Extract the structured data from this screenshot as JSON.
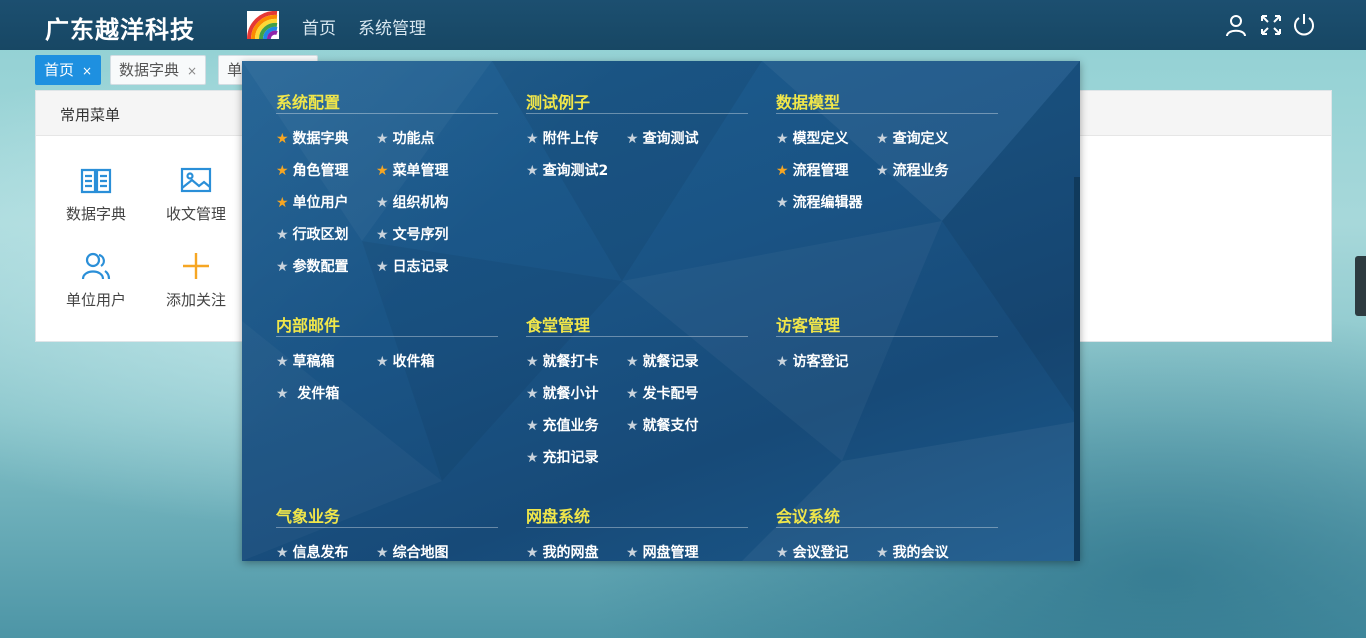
{
  "header": {
    "brand": "广东越洋科技",
    "nav": [
      {
        "label": "首页"
      },
      {
        "label": "系统管理"
      }
    ],
    "icons": [
      "user-icon",
      "fullscreen-icon",
      "power-icon"
    ]
  },
  "tabs": [
    {
      "label": "首页",
      "close": "×",
      "active": true
    },
    {
      "label": "数据字典",
      "close": "×",
      "active": false
    },
    {
      "label": "单",
      "close": "",
      "active": false
    }
  ],
  "panel": {
    "title": "常用菜单",
    "items": [
      {
        "label": "数据字典",
        "icon": "book-icon"
      },
      {
        "label": "收文管理",
        "icon": "image-icon"
      },
      {
        "label": "单位用户",
        "icon": "users-icon"
      },
      {
        "label": "添加关注",
        "icon": "plus-icon"
      }
    ]
  },
  "star": "★",
  "mega_menu": {
    "sections": [
      {
        "title": "系统配置",
        "items": [
          {
            "label": "数据字典",
            "fav": true
          },
          {
            "label": "功能点",
            "fav": false
          },
          {
            "label": "角色管理",
            "fav": true
          },
          {
            "label": "菜单管理",
            "fav": true
          },
          {
            "label": "单位用户",
            "fav": true
          },
          {
            "label": "组织机构",
            "fav": false
          },
          {
            "label": "行政区划",
            "fav": false
          },
          {
            "label": "文号序列",
            "fav": false
          },
          {
            "label": "参数配置",
            "fav": false
          },
          {
            "label": "日志记录",
            "fav": false
          }
        ]
      },
      {
        "title": "测试例子",
        "items": [
          {
            "label": "附件上传",
            "fav": false
          },
          {
            "label": "查询测试",
            "fav": false
          },
          {
            "label": "查询测试2",
            "fav": false
          }
        ]
      },
      {
        "title": "数据模型",
        "items": [
          {
            "label": "模型定义",
            "fav": false
          },
          {
            "label": "查询定义",
            "fav": false
          },
          {
            "label": "流程管理",
            "fav": true
          },
          {
            "label": "流程业务",
            "fav": false
          },
          {
            "label": "流程编辑器",
            "fav": false
          }
        ]
      },
      {
        "title": "内部邮件",
        "items": [
          {
            "label": "草稿箱",
            "fav": false
          },
          {
            "label": "收件箱",
            "fav": false
          },
          {
            "label": " 发件箱",
            "fav": false
          }
        ]
      },
      {
        "title": "食堂管理",
        "items": [
          {
            "label": "就餐打卡",
            "fav": false
          },
          {
            "label": "就餐记录",
            "fav": false
          },
          {
            "label": "就餐小计",
            "fav": false
          },
          {
            "label": "发卡配号",
            "fav": false
          },
          {
            "label": "充值业务",
            "fav": false
          },
          {
            "label": "就餐支付",
            "fav": false
          },
          {
            "label": "充扣记录",
            "fav": false
          }
        ]
      },
      {
        "title": "访客管理",
        "items": [
          {
            "label": "访客登记",
            "fav": false
          }
        ]
      },
      {
        "title": "气象业务",
        "items": [
          {
            "label": "信息发布",
            "fav": false
          },
          {
            "label": "综合地图",
            "fav": false
          }
        ]
      },
      {
        "title": "网盘系统",
        "items": [
          {
            "label": "我的网盘",
            "fav": false
          },
          {
            "label": "网盘管理",
            "fav": false
          }
        ]
      },
      {
        "title": "会议系统",
        "items": [
          {
            "label": "会议登记",
            "fav": false
          },
          {
            "label": "我的会议",
            "fav": false
          }
        ]
      }
    ]
  },
  "colors": {
    "header": "#174764",
    "accent": "#1e90e0",
    "section_title": "#f0e64a",
    "fav_star": "#f6a623",
    "menu_bg": "#1a5384"
  }
}
